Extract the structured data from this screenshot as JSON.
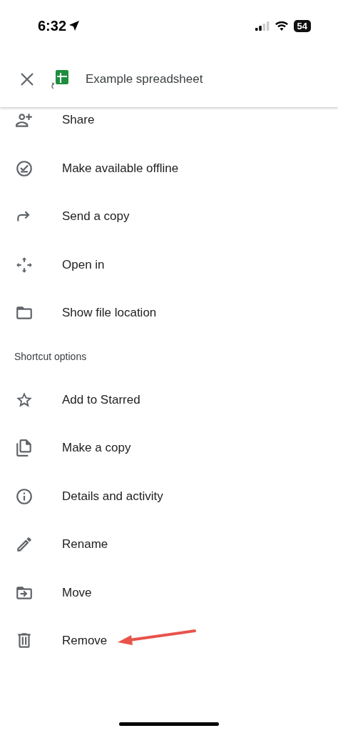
{
  "status_bar": {
    "time": "6:32",
    "battery": "54"
  },
  "header": {
    "title": "Example spreadsheet"
  },
  "menu": [
    {
      "label": "Share"
    },
    {
      "label": "Make available offline"
    },
    {
      "label": "Send a copy"
    },
    {
      "label": "Open in"
    },
    {
      "label": "Show file location"
    }
  ],
  "sections": [
    {
      "title": "Shortcut options",
      "items": [
        {
          "label": "Add to Starred"
        },
        {
          "label": "Make a copy"
        },
        {
          "label": "Details and activity"
        },
        {
          "label": "Rename"
        },
        {
          "label": "Move"
        },
        {
          "label": "Remove",
          "annotated": true
        }
      ]
    }
  ]
}
